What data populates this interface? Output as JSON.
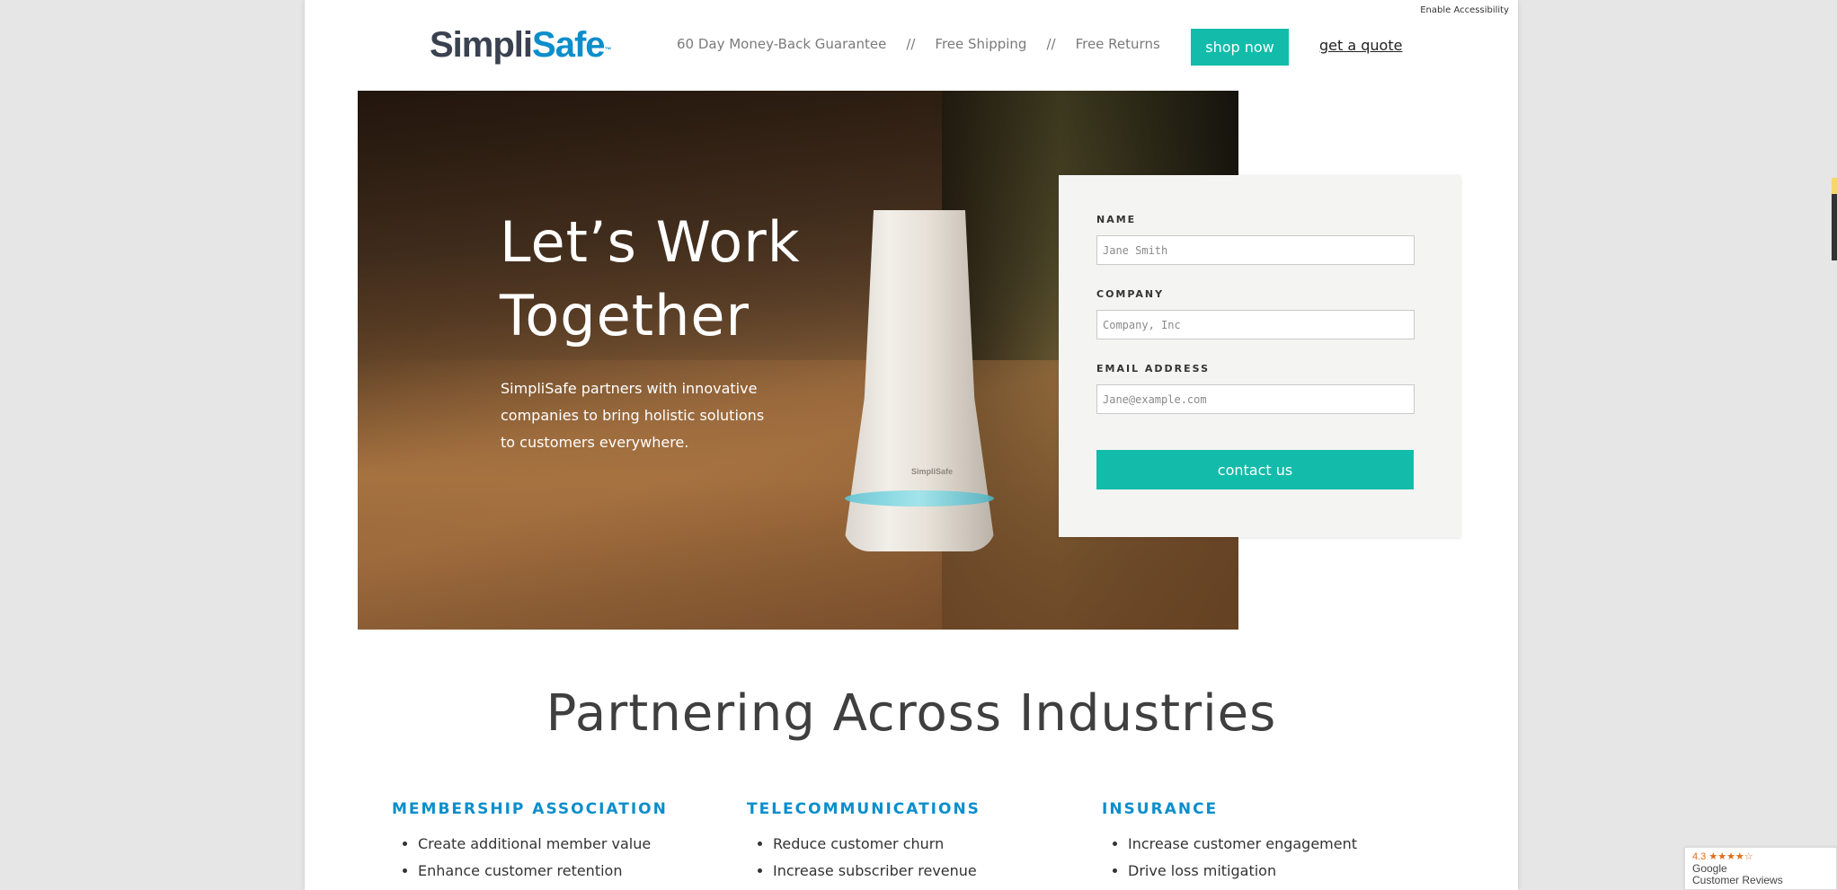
{
  "header": {
    "accessibility_link": "Enable Accessibility",
    "logo": {
      "part1": "Simpli",
      "part2": "Safe",
      "tm": "™"
    },
    "perks": [
      "60 Day Money-Back Guarantee",
      "//",
      "Free Shipping",
      "//",
      "Free Returns"
    ],
    "shop_button": "shop now",
    "quote_link": "get a quote"
  },
  "hero": {
    "title": "Let’s Work Together",
    "text": "SimpliSafe partners with innovative companies to bring holistic solutions to customers everywhere.",
    "device_brand": "SimpliSafe"
  },
  "form": {
    "name_label": "NAME",
    "name_placeholder": "Jane Smith",
    "company_label": "COMPANY",
    "company_placeholder": "Company, Inc",
    "email_label": "EMAIL ADDRESS",
    "email_placeholder": "Jane@example.com",
    "submit_label": "contact us"
  },
  "industries": {
    "title": "Partnering Across Industries",
    "columns": [
      {
        "heading": "MEMBERSHIP ASSOCIATION",
        "items": [
          "Create additional member value",
          "Enhance customer retention"
        ]
      },
      {
        "heading": "TELECOMMUNICATIONS",
        "items": [
          "Reduce customer churn",
          "Increase subscriber revenue"
        ]
      },
      {
        "heading": "INSURANCE",
        "items": [
          "Increase customer engagement",
          "Drive loss mitigation"
        ]
      }
    ]
  },
  "reviews_badge": {
    "rating": "4.3 ★★★★☆",
    "line1": "Google",
    "line2": "Customer Reviews"
  },
  "colors": {
    "accent": "#13bcaa",
    "brand_blue": "#0b8ecb",
    "brand_dark": "#3a4150"
  }
}
